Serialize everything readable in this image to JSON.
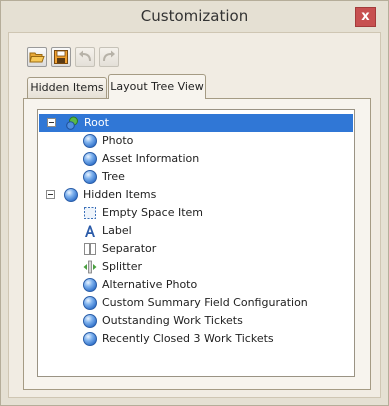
{
  "window": {
    "title": "Customization",
    "close_glyph": "x"
  },
  "toolbar": {
    "buttons": [
      {
        "name": "open-layout",
        "icon": "folder-open-icon",
        "enabled": true
      },
      {
        "name": "save-layout",
        "icon": "floppy-disk-icon",
        "enabled": true
      },
      {
        "name": "undo",
        "icon": "undo-arrow-icon",
        "enabled": false
      },
      {
        "name": "redo",
        "icon": "redo-arrow-icon",
        "enabled": false
      }
    ]
  },
  "tabs": [
    {
      "label": "Hidden Items",
      "active": false
    },
    {
      "label": "Layout Tree View",
      "active": true
    }
  ],
  "tree": {
    "root": {
      "label": "Root",
      "icon": "layout-group-icon",
      "expanded": true,
      "selected": true,
      "children": [
        "Photo",
        "Asset Information",
        "Tree"
      ]
    },
    "hidden": {
      "label": "Hidden Items",
      "icon": "blue-sphere-icon",
      "expanded": true,
      "children": [
        {
          "label": "Empty Space Item",
          "icon": "empty-space-icon"
        },
        {
          "label": "Label",
          "icon": "label-a-icon"
        },
        {
          "label": "Separator",
          "icon": "separator-icon"
        },
        {
          "label": "Splitter",
          "icon": "splitter-icon"
        },
        {
          "label": "Alternative Photo",
          "icon": "blue-sphere-icon"
        },
        {
          "label": "Custom Summary Field Configuration",
          "icon": "blue-sphere-icon"
        },
        {
          "label": "Outstanding Work Tickets",
          "icon": "blue-sphere-icon"
        },
        {
          "label": "Recently Closed 3 Work Tickets",
          "icon": "blue-sphere-icon"
        }
      ]
    }
  },
  "colors": {
    "selection": "#3077d6",
    "window_bg": "#e5e0d3",
    "close_button": "#c75050"
  }
}
